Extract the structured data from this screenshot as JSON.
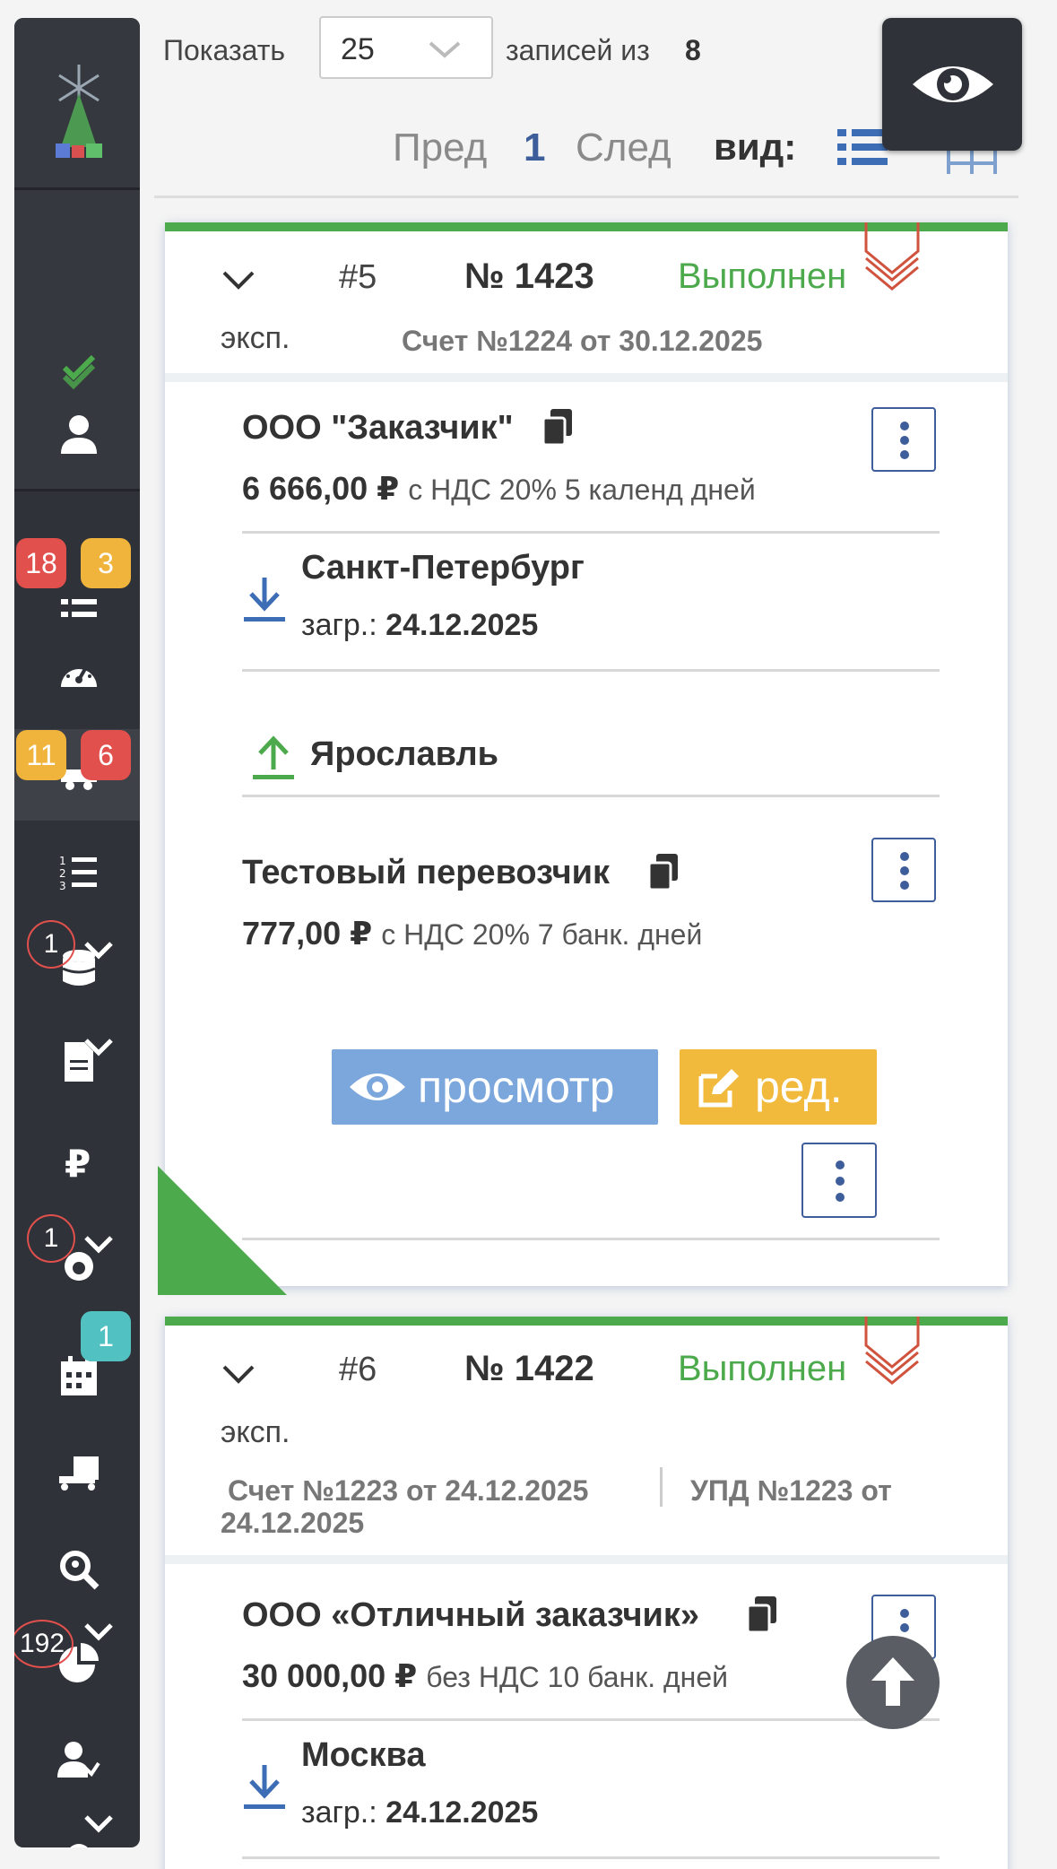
{
  "sidebar": {
    "badges": {
      "list_red": "18",
      "list_yellow": "3",
      "truck_yellow": "11",
      "truck_red": "6",
      "db_count": "1",
      "fire_count": "1",
      "calendar_count": "1",
      "chart_count": "192"
    }
  },
  "toolbar": {
    "show_label": "Показать",
    "page_size": "25",
    "records_label": "записей из",
    "records_total": "8",
    "prev": "Пред",
    "page": "1",
    "next": "След",
    "view_label": "вид:"
  },
  "orders": [
    {
      "index": "#5",
      "number": "№ 1423",
      "status": "Выполнен",
      "type": "эксп.",
      "docs": [
        "Счет №1224 от 30.12.2025"
      ],
      "customer": {
        "name": "ООО \"Заказчик\"",
        "amount": "6 666,00 ₽",
        "terms": "с НДС 20% 5 календ дней"
      },
      "loading": {
        "city": "Санкт-Петербург",
        "date_label": "загр.:",
        "date": "24.12.2025"
      },
      "unloading": {
        "city": "Ярославль"
      },
      "carrier": {
        "name": "Тестовый перевозчик",
        "amount": "777,00 ₽",
        "terms": "с НДС 20% 7 банк. дней"
      },
      "view_button": "просмотр",
      "edit_button": "ред."
    },
    {
      "index": "#6",
      "number": "№ 1422",
      "status": "Выполнен",
      "type": "эксп.",
      "docs": [
        "Счет №1223 от 24.12.2025",
        "УПД №1223 от",
        "24.12.2025"
      ],
      "customer": {
        "name": "ООО «Отличный заказчик»",
        "amount": "30 000,00 ₽",
        "terms": "без НДС 10 банк. дней"
      },
      "loading": {
        "city": "Москва",
        "date_label": "загр.:",
        "date": "24.12.2025"
      }
    }
  ],
  "colors": {
    "sidebar_bg": "#2f3238",
    "status_green": "#4caa4c",
    "accent_blue": "#3d5d9b",
    "view_button": "#7ba7dc",
    "edit_button": "#f1ba3d",
    "badge_red": "#e2504d",
    "badge_yellow": "#f0b43c",
    "badge_teal": "#52c1c1"
  },
  "icons": [
    "eye-icon",
    "list-view-icon",
    "grid-view-icon",
    "chevron-down-icon",
    "copy-icon",
    "download-icon",
    "upload-icon",
    "kebab-icon",
    "edit-icon",
    "arrow-up-icon",
    "user-icon",
    "check-icon",
    "dashboard-icon",
    "truck-icon",
    "numbered-list-icon",
    "database-icon",
    "document-icon",
    "ruble-icon",
    "fire-icon",
    "calendar-icon",
    "loader-icon",
    "search-location-icon",
    "pie-chart-icon",
    "user-check-icon"
  ]
}
